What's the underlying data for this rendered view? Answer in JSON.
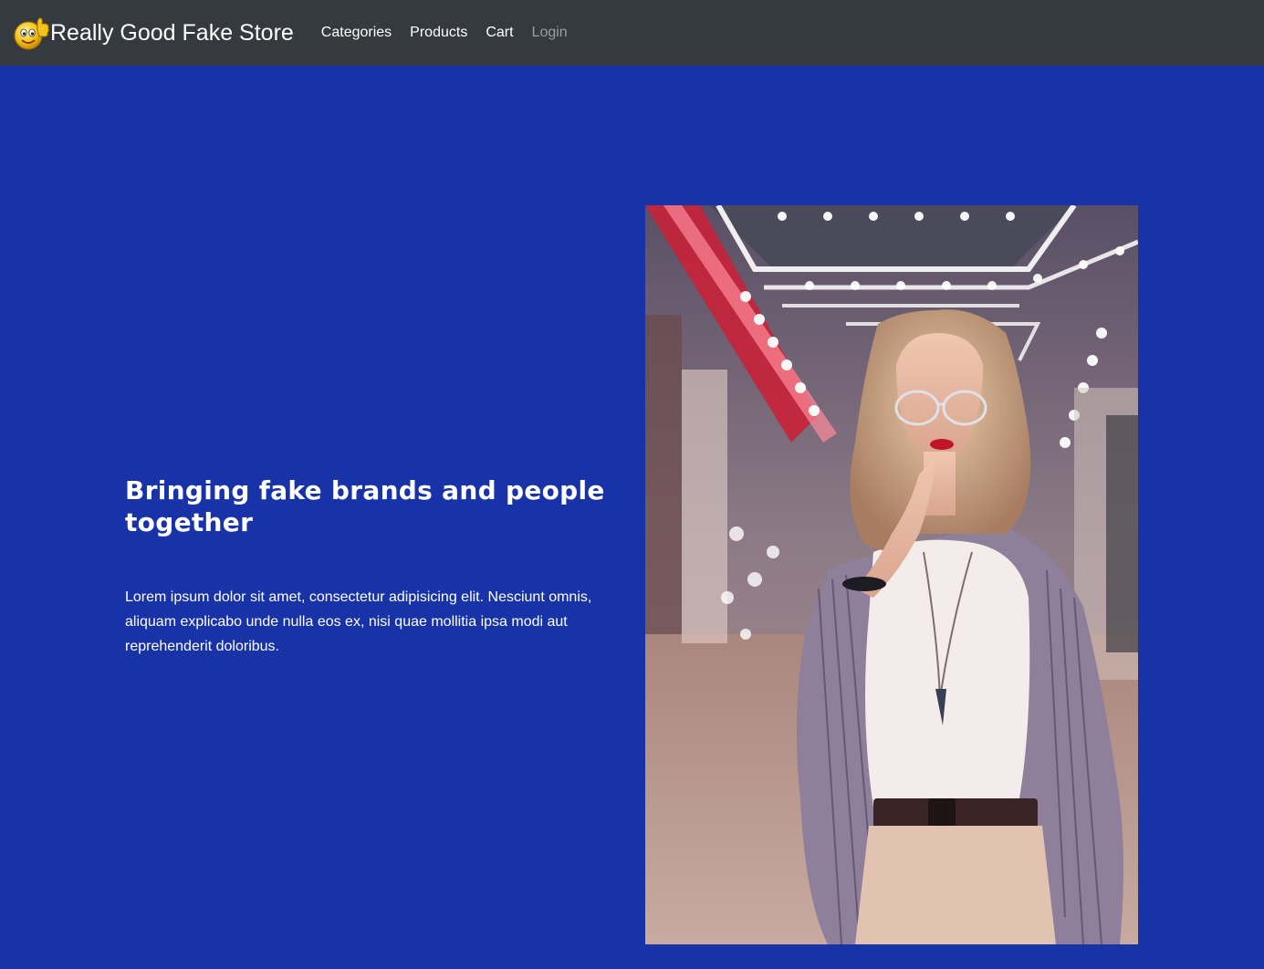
{
  "navbar": {
    "brand": "Really Good Fake Store",
    "links": [
      {
        "label": "Categories"
      },
      {
        "label": "Products"
      },
      {
        "label": "Cart"
      },
      {
        "label": "Login"
      }
    ]
  },
  "hero": {
    "heading": "Bringing fake brands and people together",
    "paragraph": "Lorem ipsum dolor sit amet, consectetur adipisicing elit. Nesciunt omnis, aliquam explicabo unde nulla eos ex, nisi quae mollitia ipsa modi aut reprehenderit doloribus.",
    "photo_alt": "woman-in-neon-corridor-photo"
  },
  "colors": {
    "navbar_bg": "#343a40",
    "page_bg": "#1832a8",
    "nav_link": "#ffffff",
    "nav_link_muted": "#9a9da1"
  },
  "icons": {
    "brand_logo": "thumbs-up-smiley-icon"
  }
}
